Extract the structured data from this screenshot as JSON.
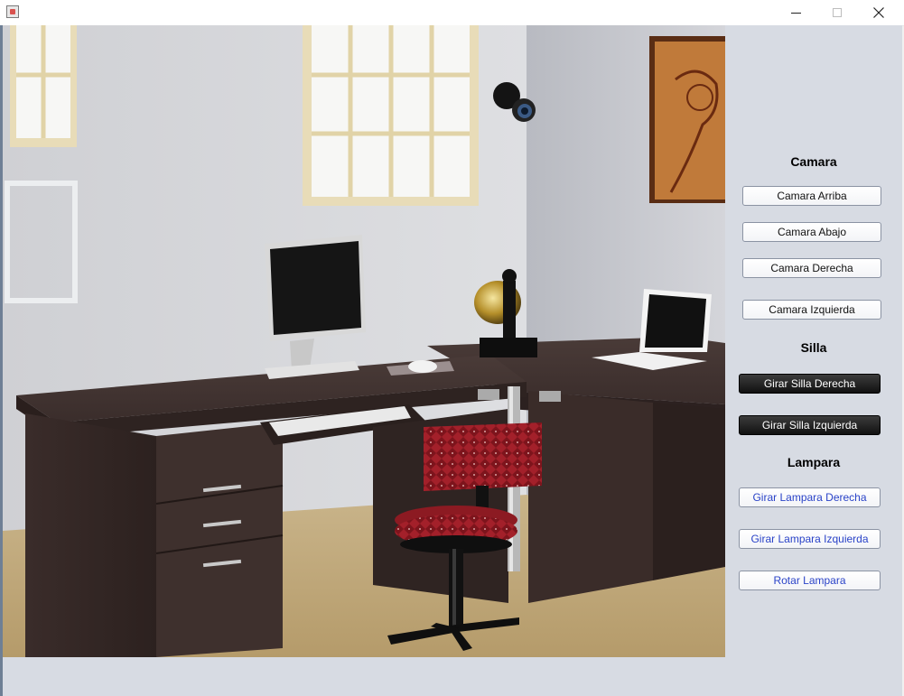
{
  "window": {
    "title": "",
    "controls": {
      "minimize": "minimize",
      "maximize": "maximize",
      "close": "close"
    }
  },
  "panel": {
    "camera": {
      "heading": "Camara",
      "buttons": [
        "Camara Arriba",
        "Camara Abajo",
        "Camara Derecha",
        "Camara Izquierda"
      ]
    },
    "chair": {
      "heading": "Silla",
      "buttons": [
        "Girar Silla Derecha",
        "Girar Silla Izquierda"
      ]
    },
    "lamp": {
      "heading": "Lampara",
      "buttons": [
        "Girar Lampara Derecha",
        "Girar Lampara Izquierda",
        "Rotar Lampara"
      ]
    }
  },
  "icons": {
    "window_icon": "java-app-icon",
    "close": "close-icon",
    "minimize": "minimize-icon",
    "maximize": "maximize-icon"
  },
  "colors": {
    "panel_bg": "#d7dbe3",
    "dark_button": "#1a1a1a",
    "lamp_button_text": "#2a43c8",
    "chair_seat": "#9b1b22"
  }
}
